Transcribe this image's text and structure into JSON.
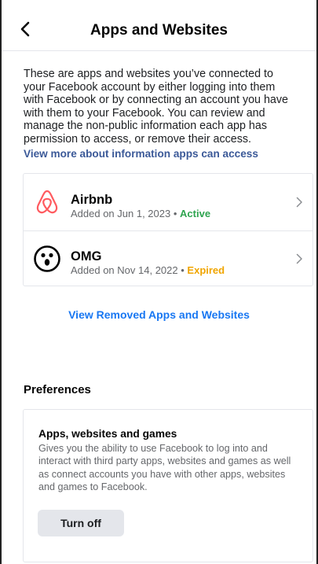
{
  "header": {
    "title": "Apps and Websites",
    "back_icon": "chevron-left-icon"
  },
  "intro": {
    "text": "These are apps and websites you’ve connected to your Facebook account by either logging into them with Facebook or by connecting an account you have with them to your Facebook. You can review and manage the non-public information each app has permission to access, or remove their access.",
    "link": "View more about information apps can access"
  },
  "apps": [
    {
      "name": "Airbnb",
      "added": "Added on Jun 1, 2023",
      "separator": "•",
      "status": "Active",
      "status_color": "#2ea44f",
      "icon": "airbnb-logo-icon"
    },
    {
      "name": "OMG",
      "added": "Added on Nov 14, 2022",
      "separator": "•",
      "status": "Expired",
      "status_color": "#f0a500",
      "icon": "omg-face-icon"
    }
  ],
  "removed_link": "View Removed Apps and Websites",
  "preferences": {
    "title": "Preferences",
    "card": {
      "heading": "Apps, websites and games",
      "description": "Gives you the ability to use Facebook to log into and interact with third party apps, websites and games as well as connect accounts you have with other apps, websites and games to Facebook.",
      "button": "Turn off"
    }
  },
  "colors": {
    "link_dark": "#3b5998",
    "link_blue": "#1877f2",
    "airbnb": "#ff5a5f"
  }
}
